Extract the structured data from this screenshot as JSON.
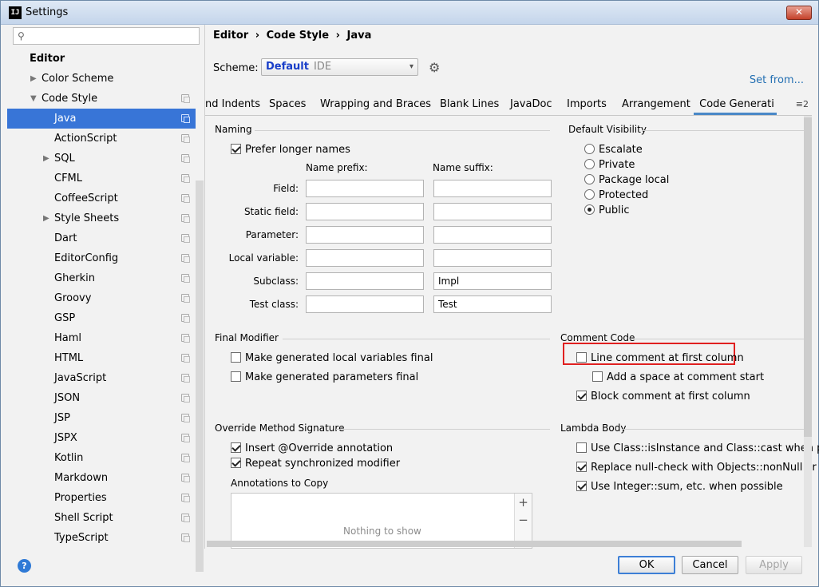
{
  "window": {
    "title": "Settings",
    "app_icon": "IJ"
  },
  "sidebar": {
    "search_placeholder": "",
    "items": [
      {
        "label": "Editor",
        "level": 0,
        "bold": true
      },
      {
        "label": "Color Scheme",
        "level": 1,
        "arrow": "right"
      },
      {
        "label": "Code Style",
        "level": 1,
        "arrow": "down",
        "copy": true
      },
      {
        "label": "Java",
        "level": 2,
        "selected": true,
        "copy": true
      },
      {
        "label": "ActionScript",
        "level": 2,
        "copy": true
      },
      {
        "label": "SQL",
        "level": 2,
        "arrow": "right",
        "copy": true
      },
      {
        "label": "CFML",
        "level": 2,
        "copy": true
      },
      {
        "label": "CoffeeScript",
        "level": 2,
        "copy": true
      },
      {
        "label": "Style Sheets",
        "level": 2,
        "arrow": "right",
        "copy": true
      },
      {
        "label": "Dart",
        "level": 2,
        "copy": true
      },
      {
        "label": "EditorConfig",
        "level": 2,
        "copy": true
      },
      {
        "label": "Gherkin",
        "level": 2,
        "copy": true
      },
      {
        "label": "Groovy",
        "level": 2,
        "copy": true
      },
      {
        "label": "GSP",
        "level": 2,
        "copy": true
      },
      {
        "label": "Haml",
        "level": 2,
        "copy": true
      },
      {
        "label": "HTML",
        "level": 2,
        "copy": true
      },
      {
        "label": "JavaScript",
        "level": 2,
        "copy": true
      },
      {
        "label": "JSON",
        "level": 2,
        "copy": true
      },
      {
        "label": "JSP",
        "level": 2,
        "copy": true
      },
      {
        "label": "JSPX",
        "level": 2,
        "copy": true
      },
      {
        "label": "Kotlin",
        "level": 2,
        "copy": true
      },
      {
        "label": "Markdown",
        "level": 2,
        "copy": true
      },
      {
        "label": "Properties",
        "level": 2,
        "copy": true
      },
      {
        "label": "Shell Script",
        "level": 2,
        "copy": true
      },
      {
        "label": "TypeScript",
        "level": 2,
        "copy": true
      }
    ]
  },
  "breadcrumb": {
    "editor": "Editor",
    "code_style": "Code Style",
    "java": "Java",
    "sep": "›"
  },
  "scheme": {
    "label": "Scheme:",
    "value": "Default",
    "hint": "IDE",
    "set_from": "Set from..."
  },
  "tabs": [
    "nd Indents",
    "Spaces",
    "Wrapping and Braces",
    "Blank Lines",
    "JavaDoc",
    "Imports",
    "Arrangement",
    "Code Generati"
  ],
  "tabs_more": "≡2",
  "naming": {
    "title": "Naming",
    "prefer_longer": "Prefer longer names",
    "prefix_head": "Name prefix:",
    "suffix_head": "Name suffix:",
    "rows": [
      {
        "label": "Field:",
        "prefix": "",
        "suffix": ""
      },
      {
        "label": "Static field:",
        "prefix": "",
        "suffix": ""
      },
      {
        "label": "Parameter:",
        "prefix": "",
        "suffix": ""
      },
      {
        "label": "Local variable:",
        "prefix": "",
        "suffix": ""
      },
      {
        "label": "Subclass:",
        "prefix": "",
        "suffix": "Impl"
      },
      {
        "label": "Test class:",
        "prefix": "",
        "suffix": "Test"
      }
    ]
  },
  "visibility": {
    "title": "Default Visibility",
    "options": [
      "Escalate",
      "Private",
      "Package local",
      "Protected",
      "Public"
    ],
    "selected": "Public"
  },
  "final_modifier": {
    "title": "Final Modifier",
    "local_vars": "Make generated local variables final",
    "params": "Make generated parameters final"
  },
  "comment_code": {
    "title": "Comment Code",
    "line_first": "Line comment at first column",
    "add_space": "Add a space at comment start",
    "block_first": "Block comment at first column"
  },
  "override": {
    "title": "Override Method Signature",
    "insert_override": "Insert @Override annotation",
    "repeat_sync": "Repeat synchronized modifier",
    "annotations_title": "Annotations to Copy",
    "empty": "Nothing to show",
    "add": "+",
    "remove": "−"
  },
  "lambda": {
    "title": "Lambda Body",
    "is_instance": "Use Class::isInstance and Class::cast when possi",
    "non_null": "Replace null-check with Objects::nonNull or Obj",
    "integer_sum": "Use Integer::sum, etc. when possible"
  },
  "footer": {
    "help": "?",
    "ok": "OK",
    "cancel": "Cancel",
    "apply": "Apply"
  }
}
